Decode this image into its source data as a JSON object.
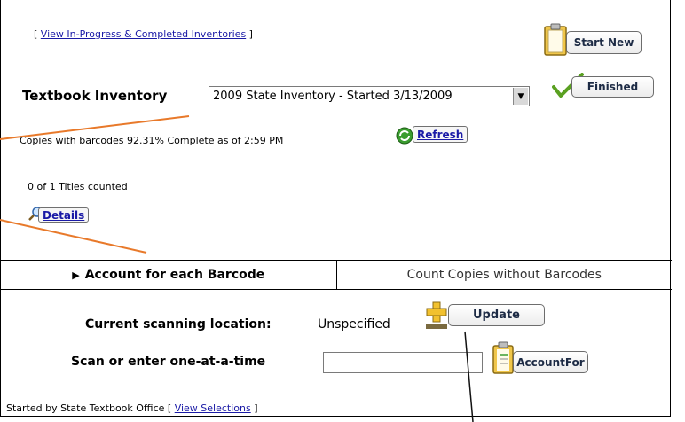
{
  "header": {
    "bracket_open": "[ ",
    "view_link": "View In-Progress & Completed Inventories",
    "bracket_close": " ]"
  },
  "buttons": {
    "start_new": "Start New",
    "finished": "Finished",
    "refresh": "Refresh",
    "details": "Details",
    "update": "Update",
    "account_for": "AccountFor"
  },
  "inventory": {
    "label": "Textbook Inventory",
    "selected": "2009 State Inventory - Started 3/13/2009",
    "status": "Copies with barcodes 92.31% Complete as of 2:59 PM",
    "titles_counted": "0 of 1 Titles counted"
  },
  "tabs": {
    "barcode": "Account for each Barcode",
    "no_barcode": "Count Copies without Barcodes"
  },
  "scanning": {
    "location_label": "Current scanning location:",
    "location_value": "Unspecified",
    "scan_label": "Scan or enter one-at-a-time",
    "scan_value": ""
  },
  "footer": {
    "started_by": "Started by State Textbook Office",
    "bracket_open": "[ ",
    "view_selections": "View Selections",
    "bracket_close": " ]"
  },
  "colors": {
    "callout_line": "#e8792a",
    "link": "#1a1aa6"
  }
}
